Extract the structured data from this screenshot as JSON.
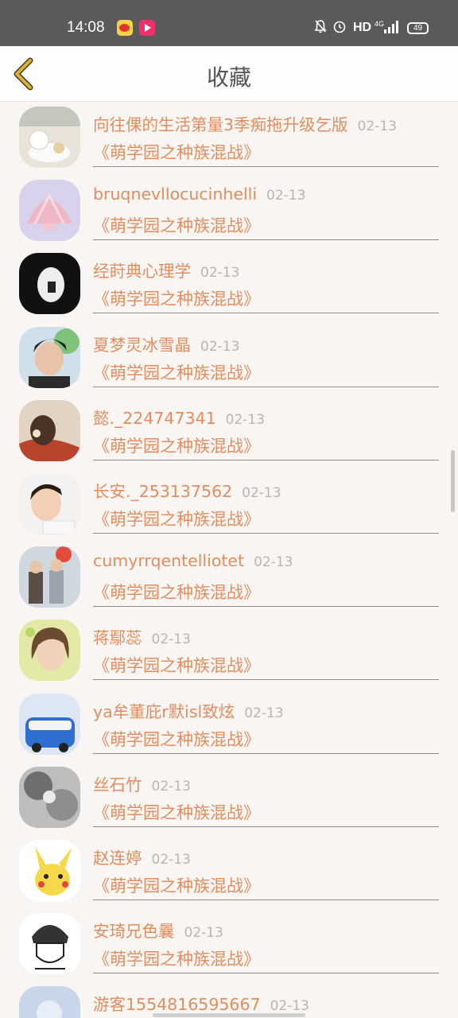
{
  "status_bar": {
    "time": "14:08",
    "network": "HD",
    "battery": "49",
    "icons": [
      "weibo-app-icon",
      "video-app-icon",
      "bell-muted-icon",
      "alarm-icon",
      "signal-4g-icon",
      "battery-icon"
    ]
  },
  "header": {
    "title": "收藏",
    "back_icon": "chevron-left-icon"
  },
  "items": [
    {
      "name": "向往倮的生活第量3季痴拖升级乞版",
      "date": "02-13",
      "book": "《萌学园之种族混战》"
    },
    {
      "name": "bruqnevllocucinhelli",
      "date": "02-13",
      "book": "《萌学园之种族混战》"
    },
    {
      "name": "经莳典心理学",
      "date": "02-13",
      "book": "《萌学园之种族混战》"
    },
    {
      "name": "夏梦灵冰雪晶",
      "date": "02-13",
      "book": "《萌学园之种族混战》"
    },
    {
      "name": "懿._224747341",
      "date": "02-13",
      "book": "《萌学园之种族混战》"
    },
    {
      "name": "长安._253137562",
      "date": "02-13",
      "book": "《萌学园之种族混战》"
    },
    {
      "name": "cumyrrqentelliotet",
      "date": "02-13",
      "book": "《萌学园之种族混战》"
    },
    {
      "name": "蒋鄢蕊",
      "date": "02-13",
      "book": "《萌学园之种族混战》"
    },
    {
      "name": "ya牟董庇r默isl致炫",
      "date": "02-13",
      "book": "《萌学园之种族混战》"
    },
    {
      "name": "丝石竹",
      "date": "02-13",
      "book": "《萌学园之种族混战》"
    },
    {
      "name": "赵连婷",
      "date": "02-13",
      "book": "《萌学园之种族混战》"
    },
    {
      "name": "安琦兄色曩",
      "date": "02-13",
      "book": "《萌学园之种族混战》"
    },
    {
      "name": "游客1554816595667",
      "date": "02-13",
      "book": ""
    }
  ],
  "colors": {
    "accent": "#e28d5e",
    "date": "#b9b5b2",
    "background": "#f8f5f3",
    "status_bar": "#5a5a5a",
    "back_arrow": "#d9b23c"
  }
}
